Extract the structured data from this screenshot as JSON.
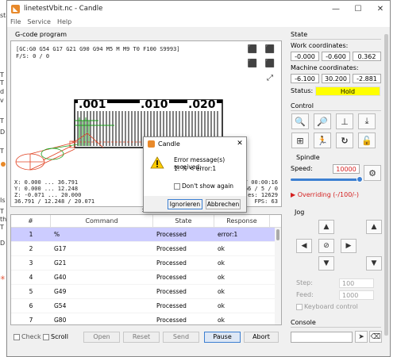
{
  "background_app": {
    "edge_texts": [
      "sta",
      "T",
      "T",
      "d",
      "v",
      "T",
      "D",
      "T",
      "Is",
      "T",
      "th",
      "T",
      "D"
    ]
  },
  "window": {
    "title": "linetestVbit.nc - Candle",
    "app_icon": "candle-app-icon",
    "minimize": "—",
    "maximize": "☐",
    "close": "✕"
  },
  "menu": [
    "File",
    "Service",
    "Help"
  ],
  "gcode": {
    "section_title": "G-code program",
    "parser_state": "[GC:G0 G54 G17 G21 G90 G94 M5 M M9 T0 F100 S9993]",
    "file_status": "F/S: 0 / 0",
    "bounds": {
      "x": "X: 0.000 ... 36.791",
      "y": "Y: 0.000 ... 12.248",
      "z": "Z: -0.071 ... 20.000",
      "dims": "36.791 / 12.248 / 20.071"
    },
    "right_info": {
      "time": "/ 00:00:16",
      "lines": "66 / 5 / 0",
      "buffer": "es: 12629",
      "fps": "FPS: 63"
    },
    "view_buttons": [
      "cube-top-icon",
      "cube-front-icon",
      "cube-left-icon",
      "cube-iso-icon",
      "fit-icon"
    ],
    "table": {
      "headers": [
        "#",
        "Command",
        "State",
        "Response"
      ],
      "rows": [
        {
          "n": "1",
          "cmd": "%",
          "state": "Processed",
          "resp": "error:1"
        },
        {
          "n": "2",
          "cmd": "G17",
          "state": "Processed",
          "resp": "ok"
        },
        {
          "n": "3",
          "cmd": "G21",
          "state": "Processed",
          "resp": "ok"
        },
        {
          "n": "4",
          "cmd": "G40",
          "state": "Processed",
          "resp": "ok"
        },
        {
          "n": "5",
          "cmd": "G49",
          "state": "Processed",
          "resp": "ok"
        },
        {
          "n": "6",
          "cmd": "G54",
          "state": "Processed",
          "resp": "ok"
        },
        {
          "n": "7",
          "cmd": "G80",
          "state": "Processed",
          "resp": "ok"
        }
      ]
    },
    "bottom": {
      "check": "Check",
      "scroll": "Scroll",
      "open": "Open",
      "reset": "Reset",
      "send": "Send",
      "pause": "Pause",
      "abort": "Abort"
    }
  },
  "state": {
    "title": "State",
    "work_label": "Work coordinates:",
    "work": [
      "-0.000",
      "-0.600",
      "0.362"
    ],
    "machine_label": "Machine coordinates:",
    "machine": [
      "-6.100",
      "30.200",
      "-2.881"
    ],
    "status_label": "Status:",
    "status_value": "Hold",
    "status_color": "#ffff00"
  },
  "control": {
    "title": "Control"
  },
  "spindle": {
    "title": "Spindle",
    "speed_label": "Speed:",
    "speed_value": "10000",
    "override": "Overriding (-/100/-)"
  },
  "jog": {
    "title": "Jog",
    "step_label": "Step:",
    "step_value": "100",
    "feed_label": "Feed:",
    "feed_value": "1000",
    "keyboard": "Keyboard control"
  },
  "console": {
    "title": "Console"
  },
  "dialog": {
    "title": "Candle",
    "message_line1": "Error message(s) received:",
    "message_line2": "1: % < error:1",
    "dont_show": "Don't show again",
    "ignore": "Ignorieren",
    "cancel": "Abbrechen",
    "close": "✕"
  },
  "ruler": {
    "labels": [
      ".001",
      ".010",
      ".020"
    ]
  },
  "colors": {
    "accent_orange": "#e8892a",
    "error_red": "#d42020",
    "selected_row": "#ccccff"
  }
}
